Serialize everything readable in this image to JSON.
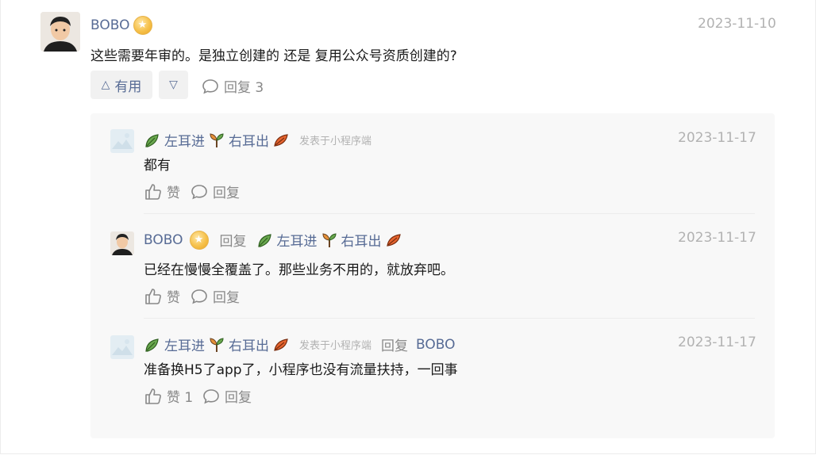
{
  "comment": {
    "author": "BOBO",
    "date": "2023-11-10",
    "text": "这些需要年审的。是独立创建的 还是 复用公众号资质创建的?",
    "useful_label": "有用",
    "reply_count_label": "回复 3"
  },
  "replies": [
    {
      "author_pre": "左耳进",
      "author_post": "右耳出",
      "source": "发表于小程序端",
      "date": "2023-11-17",
      "text": "都有",
      "like_label": "赞",
      "reply_label": "回复"
    },
    {
      "author": "BOBO",
      "reply_word": "回复",
      "target_pre": "左耳进",
      "target_post": "右耳出",
      "date": "2023-11-17",
      "text": "已经在慢慢全覆盖了。那些业务不用的，就放弃吧。",
      "like_label": "赞",
      "reply_label": "回复"
    },
    {
      "author_pre": "左耳进",
      "author_post": "右耳出",
      "source": "发表于小程序端",
      "reply_word": "回复",
      "target": "BOBO",
      "date": "2023-11-17",
      "text": "准备换H5了app了，小程序也没有流量扶持，一回事",
      "like_label": "赞 1",
      "reply_label": "回复"
    }
  ],
  "icons": {
    "badge": "star-badge-icon",
    "like": "thumb-up-icon",
    "comment": "comment-bubble-icon",
    "leaf_green": "green-leaf-icon",
    "leaf_orange": "orange-leaf-icon",
    "plant": "sprout-icon"
  },
  "colors": {
    "name": "#576b95",
    "date": "#b2b2b2",
    "panel": "#f8f8f8"
  }
}
